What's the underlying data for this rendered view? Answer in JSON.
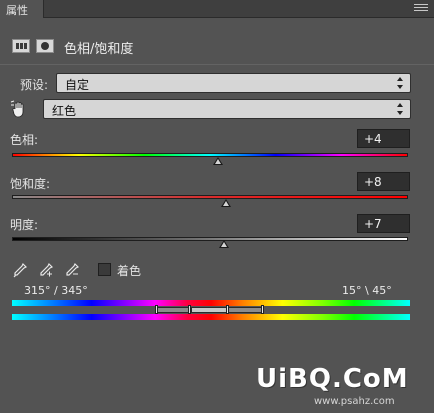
{
  "panel": {
    "tab_label": "属性",
    "title": "色相/饱和度"
  },
  "preset": {
    "label": "预设:",
    "value": "自定"
  },
  "channel": {
    "value": "红色"
  },
  "sliders": {
    "hue": {
      "label": "色相:",
      "value": "+4",
      "fraction": 0.52
    },
    "saturation": {
      "label": "饱和度:",
      "value": "+8",
      "fraction": 0.54
    },
    "lightness": {
      "label": "明度:",
      "value": "+7",
      "fraction": 0.535
    }
  },
  "colorize": {
    "label": "着色",
    "checked": false
  },
  "range": {
    "left_text": "315° / 345°",
    "right_text": "15° \\ 45°"
  },
  "watermark": {
    "main": "UiBQ.CoM",
    "sub": "www.psahz.com"
  },
  "icons": {
    "tab_menu": "panel-menu-icon",
    "adjustment": "adjustment-layer-icon",
    "mask": "layer-mask-icon",
    "target": "targeted-adjustment-hand-icon",
    "eyedropper": "eyedropper-icon",
    "eyedropper_plus": "eyedropper-plus-icon",
    "eyedropper_minus": "eyedropper-minus-icon"
  },
  "colors": {
    "panel_bg": "#535353",
    "field_bg": "#2f2f2f",
    "select_bg": "#d6d6d6"
  }
}
